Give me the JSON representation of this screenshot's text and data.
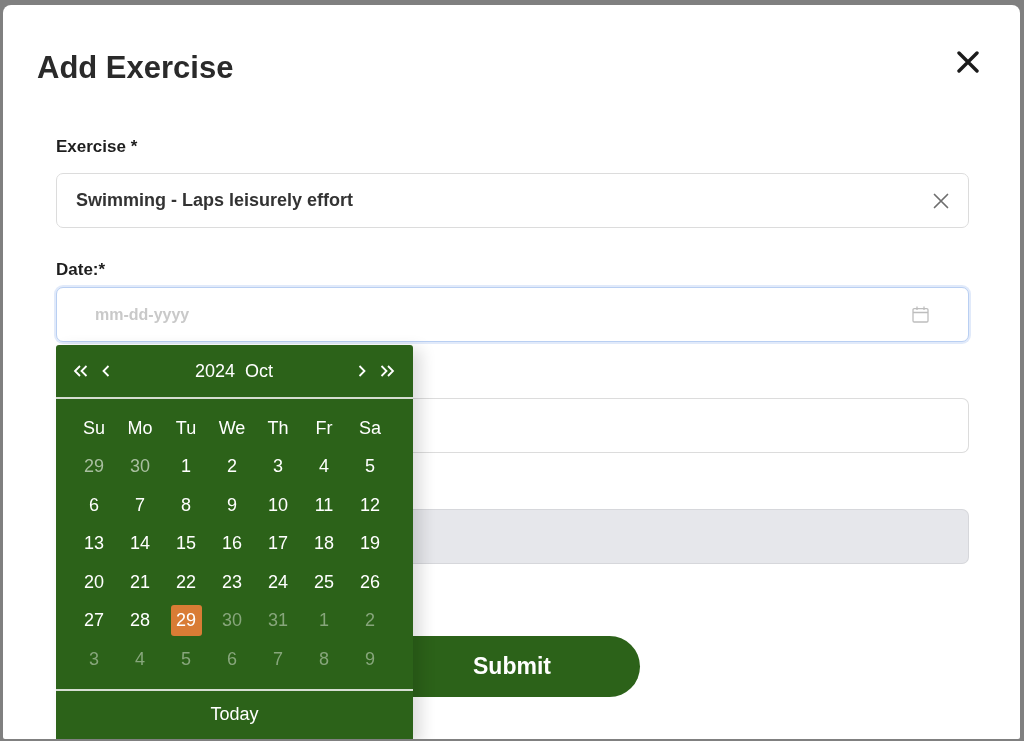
{
  "dialog": {
    "title": "Add Exercise"
  },
  "fields": [
    {
      "kind": "combo",
      "label": "Exercise *",
      "value": "Swimming - Laps leisurely effort",
      "focused": false,
      "disabled": false
    },
    {
      "kind": "date",
      "label": "Date:*",
      "placeholder": "mm-dd-yyyy",
      "focused": true,
      "disabled": false,
      "picker": {
        "year": "2024",
        "month": "Oct",
        "weekdays": [
          "Su",
          "Mo",
          "Tu",
          "We",
          "Th",
          "Fr",
          "Sa"
        ],
        "days": [
          {
            "label": "29",
            "kind": "outside",
            "selected": false
          },
          {
            "label": "30",
            "kind": "outside",
            "selected": false
          },
          {
            "label": "1",
            "kind": "day",
            "selected": false
          },
          {
            "label": "2",
            "kind": "day",
            "selected": false
          },
          {
            "label": "3",
            "kind": "day",
            "selected": false
          },
          {
            "label": "4",
            "kind": "day",
            "selected": false
          },
          {
            "label": "5",
            "kind": "day",
            "selected": false
          },
          {
            "label": "6",
            "kind": "day",
            "selected": false
          },
          {
            "label": "7",
            "kind": "day",
            "selected": false
          },
          {
            "label": "8",
            "kind": "day",
            "selected": false
          },
          {
            "label": "9",
            "kind": "day",
            "selected": false
          },
          {
            "label": "10",
            "kind": "day",
            "selected": false
          },
          {
            "label": "11",
            "kind": "day",
            "selected": false
          },
          {
            "label": "12",
            "kind": "day",
            "selected": false
          },
          {
            "label": "13",
            "kind": "day",
            "selected": false
          },
          {
            "label": "14",
            "kind": "day",
            "selected": false
          },
          {
            "label": "15",
            "kind": "day",
            "selected": false
          },
          {
            "label": "16",
            "kind": "day",
            "selected": false
          },
          {
            "label": "17",
            "kind": "day",
            "selected": false
          },
          {
            "label": "18",
            "kind": "day",
            "selected": false
          },
          {
            "label": "19",
            "kind": "day",
            "selected": false
          },
          {
            "label": "20",
            "kind": "day",
            "selected": false
          },
          {
            "label": "21",
            "kind": "day",
            "selected": false
          },
          {
            "label": "22",
            "kind": "day",
            "selected": false
          },
          {
            "label": "23",
            "kind": "day",
            "selected": false
          },
          {
            "label": "24",
            "kind": "day",
            "selected": false
          },
          {
            "label": "25",
            "kind": "day",
            "selected": false
          },
          {
            "label": "26",
            "kind": "day",
            "selected": false
          },
          {
            "label": "27",
            "kind": "day",
            "selected": false
          },
          {
            "label": "28",
            "kind": "day",
            "selected": false
          },
          {
            "label": "29",
            "kind": "day",
            "selected": true
          },
          {
            "label": "30",
            "kind": "disabled",
            "selected": false
          },
          {
            "label": "31",
            "kind": "disabled",
            "selected": false
          },
          {
            "label": "1",
            "kind": "disabled",
            "selected": false
          },
          {
            "label": "2",
            "kind": "disabled",
            "selected": false
          },
          {
            "label": "3",
            "kind": "disabled",
            "selected": false
          },
          {
            "label": "4",
            "kind": "disabled",
            "selected": false
          },
          {
            "label": "5",
            "kind": "disabled",
            "selected": false
          },
          {
            "label": "6",
            "kind": "disabled",
            "selected": false
          },
          {
            "label": "7",
            "kind": "disabled",
            "selected": false
          },
          {
            "label": "8",
            "kind": "disabled",
            "selected": false
          },
          {
            "label": "9",
            "kind": "disabled",
            "selected": false
          }
        ],
        "footer": "Today"
      }
    },
    {
      "kind": "text",
      "focused": false,
      "disabled": false
    },
    {
      "kind": "text",
      "focused": false,
      "disabled": true
    }
  ],
  "submit": {
    "label": "Submit"
  }
}
